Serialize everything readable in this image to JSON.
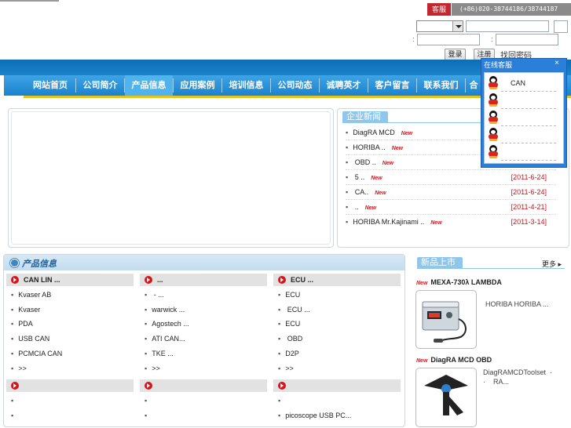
{
  "header": {
    "kefu_label": "客服",
    "phones": "(+86)020-38744186/38744187",
    "login_button": "登录",
    "register_button": "注册",
    "forgot_link": "找回密码",
    "colon1": ":",
    "colon2": ":"
  },
  "nav": {
    "items": [
      "网站首页",
      "公司简介",
      "产品信息",
      "应用案例",
      "培训信息",
      "公司动态",
      "诚聘英才",
      "客户留言",
      "联系我们",
      "合"
    ]
  },
  "news": {
    "tab_title": "企业新闻",
    "new_tag": "New",
    "items": [
      {
        "title": "DiagRA MCD",
        "date": ""
      },
      {
        "title": "HORIBA             ..",
        "date": ""
      },
      {
        "title": "  OBD             ..",
        "date": ""
      },
      {
        "title": "  5           ..",
        "date": "[2011-6-24]"
      },
      {
        "title": "               CA..",
        "date": "[2011-6-24]"
      },
      {
        "title": "                ..",
        "date": "[2011-4-21]"
      },
      {
        "title": "HORIBA        Mr.Kajinami ..",
        "date": "[2011-3-14]"
      }
    ]
  },
  "online_service": {
    "title": "在线客服",
    "close": "×",
    "contacts": [
      "CAN",
      "",
      "",
      "",
      ""
    ]
  },
  "products": {
    "section_title": "产品信息",
    "bullet": "▪",
    "col1": {
      "heading": "CAN  LIN          ...",
      "items": [
        "Kvaser AB",
        "Kvaser",
        "PDA",
        "USB CAN",
        "PCMCIA CAN",
        ">>"
      ],
      "heading2": "",
      "items2": [
        "",
        ""
      ]
    },
    "col2": {
      "heading": "                     ...",
      "items": [
        "   -        ...",
        "warwick        ...",
        "Agostech     ...",
        "ATI        CAN...",
        "TKE           ...",
        ">>"
      ],
      "heading2": "",
      "items2": [
        "",
        ""
      ]
    },
    "col3": {
      "heading": "   ECU            ...",
      "items": [
        "ECU",
        "   ECU          ...",
        "ECU",
        "   OBD",
        "D2P",
        ">>"
      ],
      "heading2": "",
      "items2": [
        "",
        "picoscope USB PC..."
      ]
    }
  },
  "new_products": {
    "tab_title": "新品上市",
    "more": "更多",
    "new_tag": "New",
    "items": [
      {
        "name": "MEXA-730λ              LAMBDA",
        "desc": "HORIBA          HORIBA ..."
      },
      {
        "name": "DiagRA MCD     OBD",
        "desc": "DiagRAMCDToolset  · ·    RA..."
      }
    ]
  }
}
